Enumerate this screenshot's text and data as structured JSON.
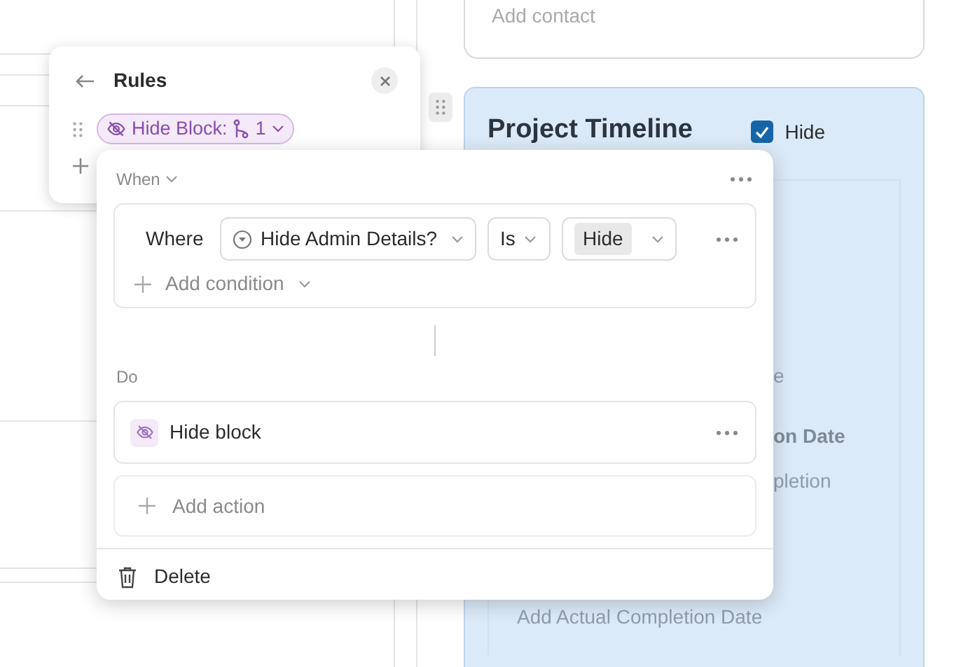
{
  "background": {
    "contact_placeholder": "Add contact",
    "card": {
      "title": "Project Timeline",
      "hide_checked": true,
      "hide_label": "Hide",
      "fields": [
        {
          "text": "e",
          "kind": "placeholder",
          "partly_hidden": true
        },
        {
          "text": "on Date",
          "kind": "label",
          "partly_hidden": true
        },
        {
          "text": "pletion",
          "kind": "placeholder",
          "partly_hidden": true
        },
        {
          "text": "Add Actual Completion Date",
          "kind": "placeholder",
          "partly_hidden": false
        }
      ]
    }
  },
  "rules_panel": {
    "title": "Rules",
    "rules": [
      {
        "label": "Hide Block:",
        "count": "1"
      }
    ]
  },
  "rule_editor": {
    "when_label": "When",
    "conditions": [
      {
        "prefix": "Where",
        "field": "Hide Admin Details?",
        "operator": "Is",
        "value": "Hide"
      }
    ],
    "add_condition": "Add condition",
    "do_label": "Do",
    "actions": [
      {
        "label": "Hide block"
      }
    ],
    "add_action": "Add action",
    "delete": "Delete"
  }
}
